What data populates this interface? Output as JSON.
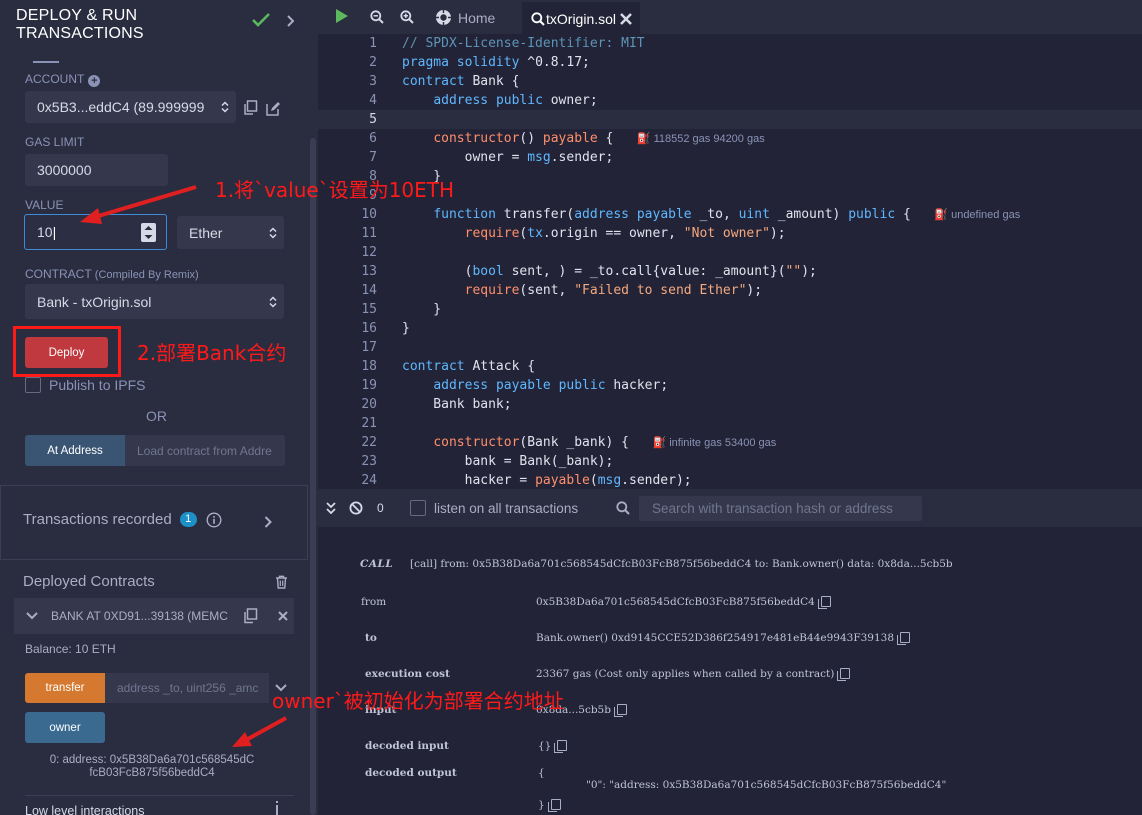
{
  "panel": {
    "title_line1": "DEPLOY & RUN",
    "title_line2": "TRANSACTIONS",
    "account_label": "ACCOUNT",
    "account_value": "0x5B3...eddC4 (89.999999",
    "gas_limit_label": "GAS LIMIT",
    "gas_limit_value": "3000000",
    "value_label": "VALUE",
    "value_amount": "10",
    "value_unit": "Ether",
    "contract_label": "CONTRACT",
    "contract_sublabel": "(Compiled By Remix)",
    "contract_value": "Bank - txOrigin.sol",
    "deploy_label": "Deploy",
    "publish_label": "Publish to IPFS",
    "or_label": "OR",
    "at_address_label": "At Address",
    "at_address_placeholder": "Load contract from Addre",
    "transactions_label": "Transactions recorded",
    "transactions_count": "1",
    "deployed_label": "Deployed Contracts",
    "instance_label": "BANK AT 0XD91...39138 (MEMC",
    "balance": "Balance: 10 ETH",
    "transfer_label": "transfer",
    "transfer_placeholder": "address _to, uint256 _amc",
    "owner_label": "owner",
    "owner_result_line1": "0:  address: 0x5B38Da6a701c568545dC",
    "owner_result_line2": "fcB03FcB875f56beddC4",
    "low_level_label": "Low level interactions"
  },
  "toolbar": {
    "home_label": "Home",
    "file_tab_label": "txOrigin.sol"
  },
  "editor": {
    "lines": [
      "1",
      "2",
      "3",
      "4",
      "5",
      "6",
      "7",
      "8",
      "9",
      "10",
      "11",
      "12",
      "13",
      "14",
      "15",
      "16",
      "17",
      "18",
      "19",
      "20",
      "21",
      "22",
      "23",
      "24"
    ],
    "gas_hints": {
      "constructor": "118552 gas 94200 gas",
      "transfer": "undefined gas",
      "attack_constructor": "infinite gas 53400 gas"
    }
  },
  "terminal": {
    "count": "0",
    "listen_label": "listen on all transactions",
    "search_placeholder": "Search with transaction hash or address",
    "call_badge": "CALL",
    "call_header": "[call]  from: 0x5B38Da6a701c568545dCfcB03FcB875f56beddC4 to: Bank.owner() data: 0x8da...5cb5b",
    "rows": [
      {
        "key": "from",
        "value": "0x5B38Da6a701c568545dCfcB03FcB875f56beddC4"
      },
      {
        "key": "to",
        "value": "Bank.owner() 0xd9145CCE52D386f254917e481eB44e9943F39138"
      },
      {
        "key": "execution cost",
        "value": "23367 gas (Cost only applies when called by a contract)"
      },
      {
        "key": "input",
        "value": "0x8da...5cb5b"
      },
      {
        "key": "decoded input",
        "value": "{}"
      },
      {
        "key": "decoded output",
        "value": "{"
      }
    ],
    "decoded_output_body": "\"0\": \"address: 0x5B38Da6a701c568545dCfcB03FcB875f56beddC4\"",
    "decoded_output_close": "}"
  },
  "annotations": {
    "step1": "1.将`value`设置为10ETH",
    "step2": "2.部署Bank合约",
    "step3": "owner`被初始化为部署合约地址"
  },
  "colors": {
    "annotation": "#ff1a1a",
    "deploy_button": "#c0393e",
    "transfer_button": "#d4792f",
    "owner_button": "#3a6a90",
    "check": "#5cb85c",
    "badge": "#1e90c8"
  }
}
